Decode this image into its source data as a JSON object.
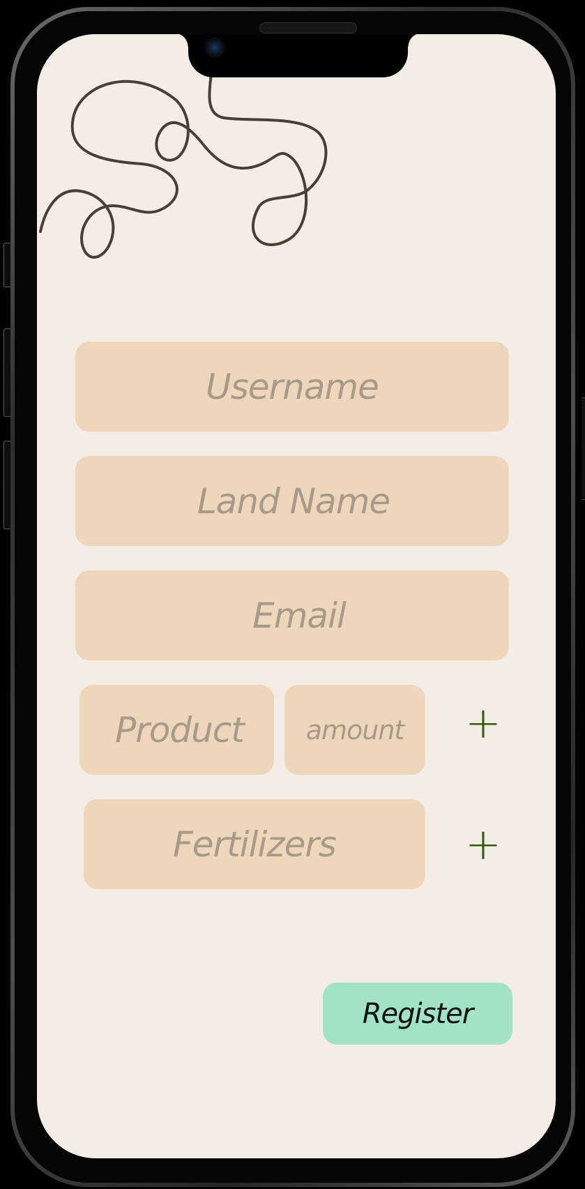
{
  "form": {
    "username_placeholder": "Username",
    "land_name_placeholder": "Land Name",
    "email_placeholder": "Email",
    "product_placeholder": "Product",
    "amount_placeholder": "amount",
    "fertilizers_placeholder": "Fertilizers",
    "add_product_label": "+",
    "add_fertilizer_label": "+",
    "register_label": "Register"
  },
  "icons": {
    "add_product": "plus-icon",
    "add_fertilizer": "plus-icon",
    "decoration": "squiggle-line-decoration"
  },
  "colors": {
    "background": "#f3ede6",
    "field": "#edd6b9",
    "placeholder_text": "#a79a8b",
    "accent_plus": "#2f5a10",
    "register_button": "#a1e3c4",
    "doodle_stroke": "#4a3f36"
  }
}
